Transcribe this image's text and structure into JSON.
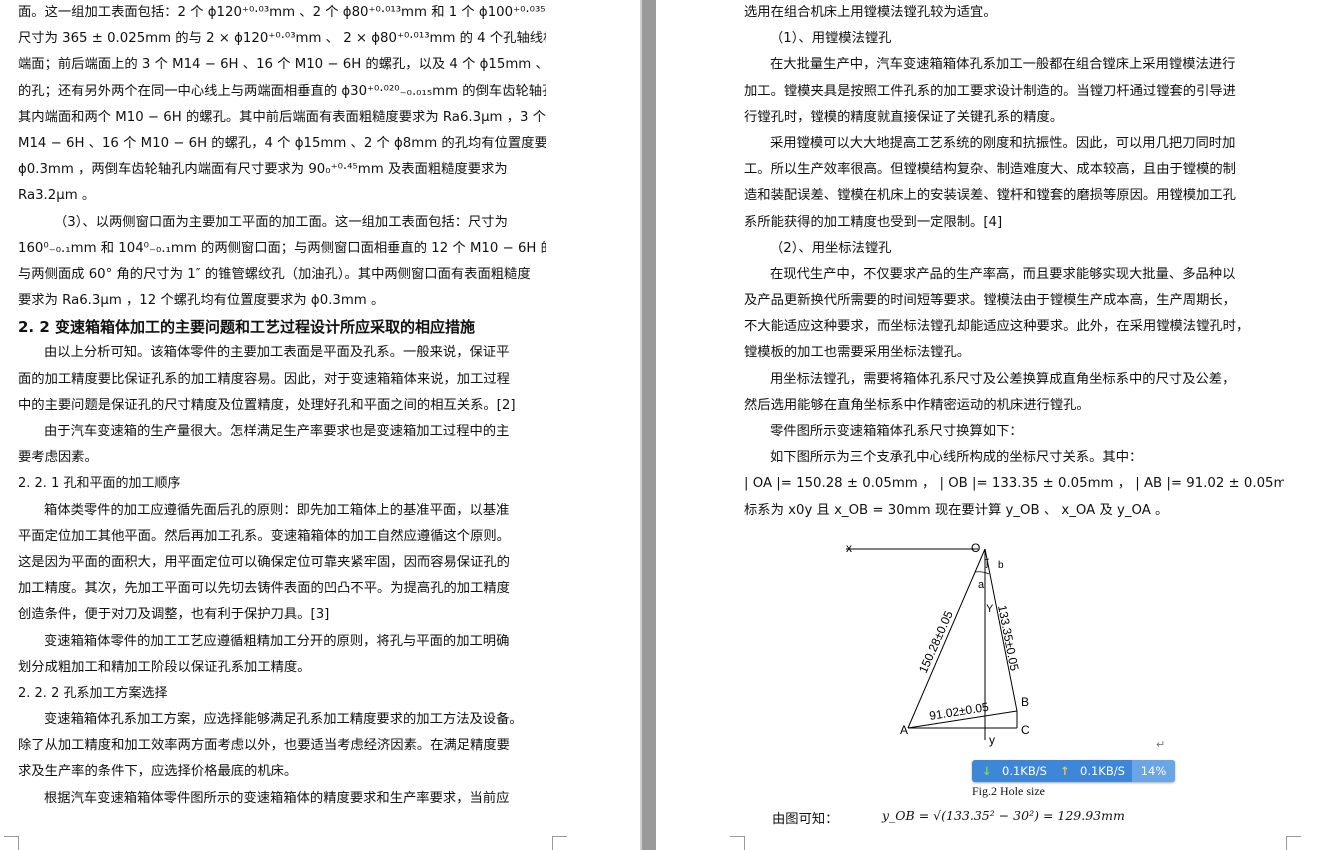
{
  "left_page": {
    "lines": [
      "面。这一组加工表面包括：2 个 ϕ120⁺⁰·⁰³mm 、2 个 ϕ80⁺⁰·⁰¹³mm 和 1 个 ϕ100⁺⁰·⁰³⁵mm 的孔；",
      "尺寸为 365 ± 0.025mm 的与 2 × ϕ120⁺⁰·⁰³mm 、 2 × ϕ80⁺⁰·⁰¹³mm 的 4 个孔轴线相垂直的前后",
      "端面；前后端面上的 3 个 M14 − 6H 、16 个 M10 − 6H 的螺孔，以及 4 个 ϕ15mm 、2 个 ϕ8mm",
      "的孔；还有另外两个在同一中心线上与两端面相垂直的 ϕ30⁺⁰·⁰²⁰₋₀.₀₁₅mm 的倒车齿轮轴孔及",
      "其内端面和两个 M10 − 6H 的螺孔。其中前后端面有表面粗糙度要求为 Ra6.3μm ，3 个",
      "M14 − 6H 、16 个 M10 − 6H 的螺孔，4 个 ϕ15mm 、2 个 ϕ8mm 的孔均有位置度要求为",
      "ϕ0.3mm ，两倒车齿轮轴孔内端面有尺寸要求为 90₀⁺⁰·⁴⁵mm 及表面粗糙度要求为",
      "Ra3.2μm 。",
      "（3）、以两侧窗口面为主要加工平面的加工面。这一组加工表面包括：尺寸为",
      "160⁰₋₀.₁mm 和 104⁰₋₀.₁mm 的两侧窗口面；与两侧窗口面相垂直的 12 个 M10 − 6H 的螺孔；",
      "与两侧面成 60° 角的尺寸为 1″ 的锥管螺纹孔（加油孔）。其中两侧窗口面有表面粗糙度",
      "要求为 Ra6.3μm ，12 个螺孔均有位置度要求为 ϕ0.3mm 。",
      "2. 2 变速箱箱体加工的主要问题和工艺过程设计所应采取的相应措施",
      "由以上分析可知。该箱体零件的主要加工表面是平面及孔系。一般来说，保证平",
      "面的加工精度要比保证孔系的加工精度容易。因此，对于变速箱箱体来说，加工过程",
      "中的主要问题是保证孔的尺寸精度及位置精度，处理好孔和平面之间的相互关系。[2]",
      "由于汽车变速箱的生产量很大。怎样满足生产率要求也是变速箱加工过程中的主",
      "要考虑因素。",
      "2. 2. 1  孔和平面的加工顺序",
      "箱体类零件的加工应遵循先面后孔的原则：即先加工箱体上的基准平面，以基准",
      "平面定位加工其他平面。然后再加工孔系。变速箱箱体的加工自然应遵循这个原则。",
      "这是因为平面的面积大，用平面定位可以确保定位可靠夹紧牢固，因而容易保证孔的",
      "加工精度。其次，先加工平面可以先切去铸件表面的凹凸不平。为提高孔的加工精度",
      "创造条件，便于对刀及调整，也有利于保护刀具。[3]",
      "变速箱箱体零件的加工工艺应遵循粗精加工分开的原则，将孔与平面的加工明确",
      "划分成粗加工和精加工阶段以保证孔系加工精度。",
      "2. 2. 2  孔系加工方案选择",
      "变速箱箱体孔系加工方案，应选择能够满足孔系加工精度要求的加工方法及设备。",
      "除了从加工精度和加工效率两方面考虑以外，也要适当考虑经济因素。在满足精度要",
      "求及生产率的条件下，应选择价格最底的机床。",
      "根据汽车变速箱箱体零件图所示的变速箱箱体的精度要求和生产率要求，当前应"
    ]
  },
  "right_page": {
    "lines": [
      "选用在组合机床上用镗模法镗孔较为适宜。",
      "（1）、用镗模法镗孔",
      "在大批量生产中，汽车变速箱箱体孔系加工一般都在组合镗床上采用镗模法进行",
      "加工。镗模夹具是按照工件孔系的加工要求设计制造的。当镗刀杆通过镗套的引导进",
      "行镗孔时，镗模的精度就直接保证了关键孔系的精度。",
      "采用镗模可以大大地提高工艺系统的刚度和抗振性。因此，可以用几把刀同时加",
      "工。所以生产效率很高。但镗模结构复杂、制造难度大、成本较高，且由于镗模的制",
      "造和装配误差、镗模在机床上的安装误差、镗杆和镗套的磨损等原因。用镗模加工孔",
      "系所能获得的加工精度也受到一定限制。[4]",
      "（2）、用坐标法镗孔",
      "在现代生产中，不仅要求产品的生产率高，而且要求能够实现大批量、多品种以",
      "及产品更新换代所需要的时间短等要求。镗模法由于镗模生产成本高，生产周期长，",
      "不大能适应这种要求，而坐标法镗孔却能适应这种要求。此外，在采用镗模法镗孔时，",
      "镗模板的加工也需要采用坐标法镗孔。",
      "用坐标法镗孔，需要将箱体孔系尺寸及公差换算成直角坐标系中的尺寸及公差，",
      "然后选用能够在直角坐标系中作精密运动的机床进行镗孔。",
      "零件图所示变速箱箱体孔系尺寸换算如下：",
      "如下图所示为三个支承孔中心线所构成的坐标尺寸关系。其中：",
      "| OA |= 150.28 ± 0.05mm ， | OB |= 133.35 ± 0.05mm ， | AB |= 91.02 ± 0.05mm 。设加工时坐",
      "标系为 x0y 且 x_OB = 30mm 现在要计算 y_OB 、 x_OA 及 y_OA 。"
    ],
    "figure": {
      "label_x": "x",
      "label_o": "O",
      "label_j": "j",
      "label_b_top": "b",
      "label_a_angle": "a",
      "label_gamma": "Y",
      "label_oa": "150.28±0.05",
      "label_ob": "133.35±0.05",
      "label_ab": "91.02±0.05",
      "label_a": "A",
      "label_b": "B",
      "label_c": "C",
      "label_y": "y"
    },
    "caption": "Fig.2 Hole size",
    "result_prefix": "由图可知：",
    "result_formula": "y_OB = √(133.35² − 30²) = 129.93mm"
  },
  "network_overlay": {
    "down": "0.1KB/S",
    "up": "0.1KB/S",
    "percent": "14%"
  }
}
